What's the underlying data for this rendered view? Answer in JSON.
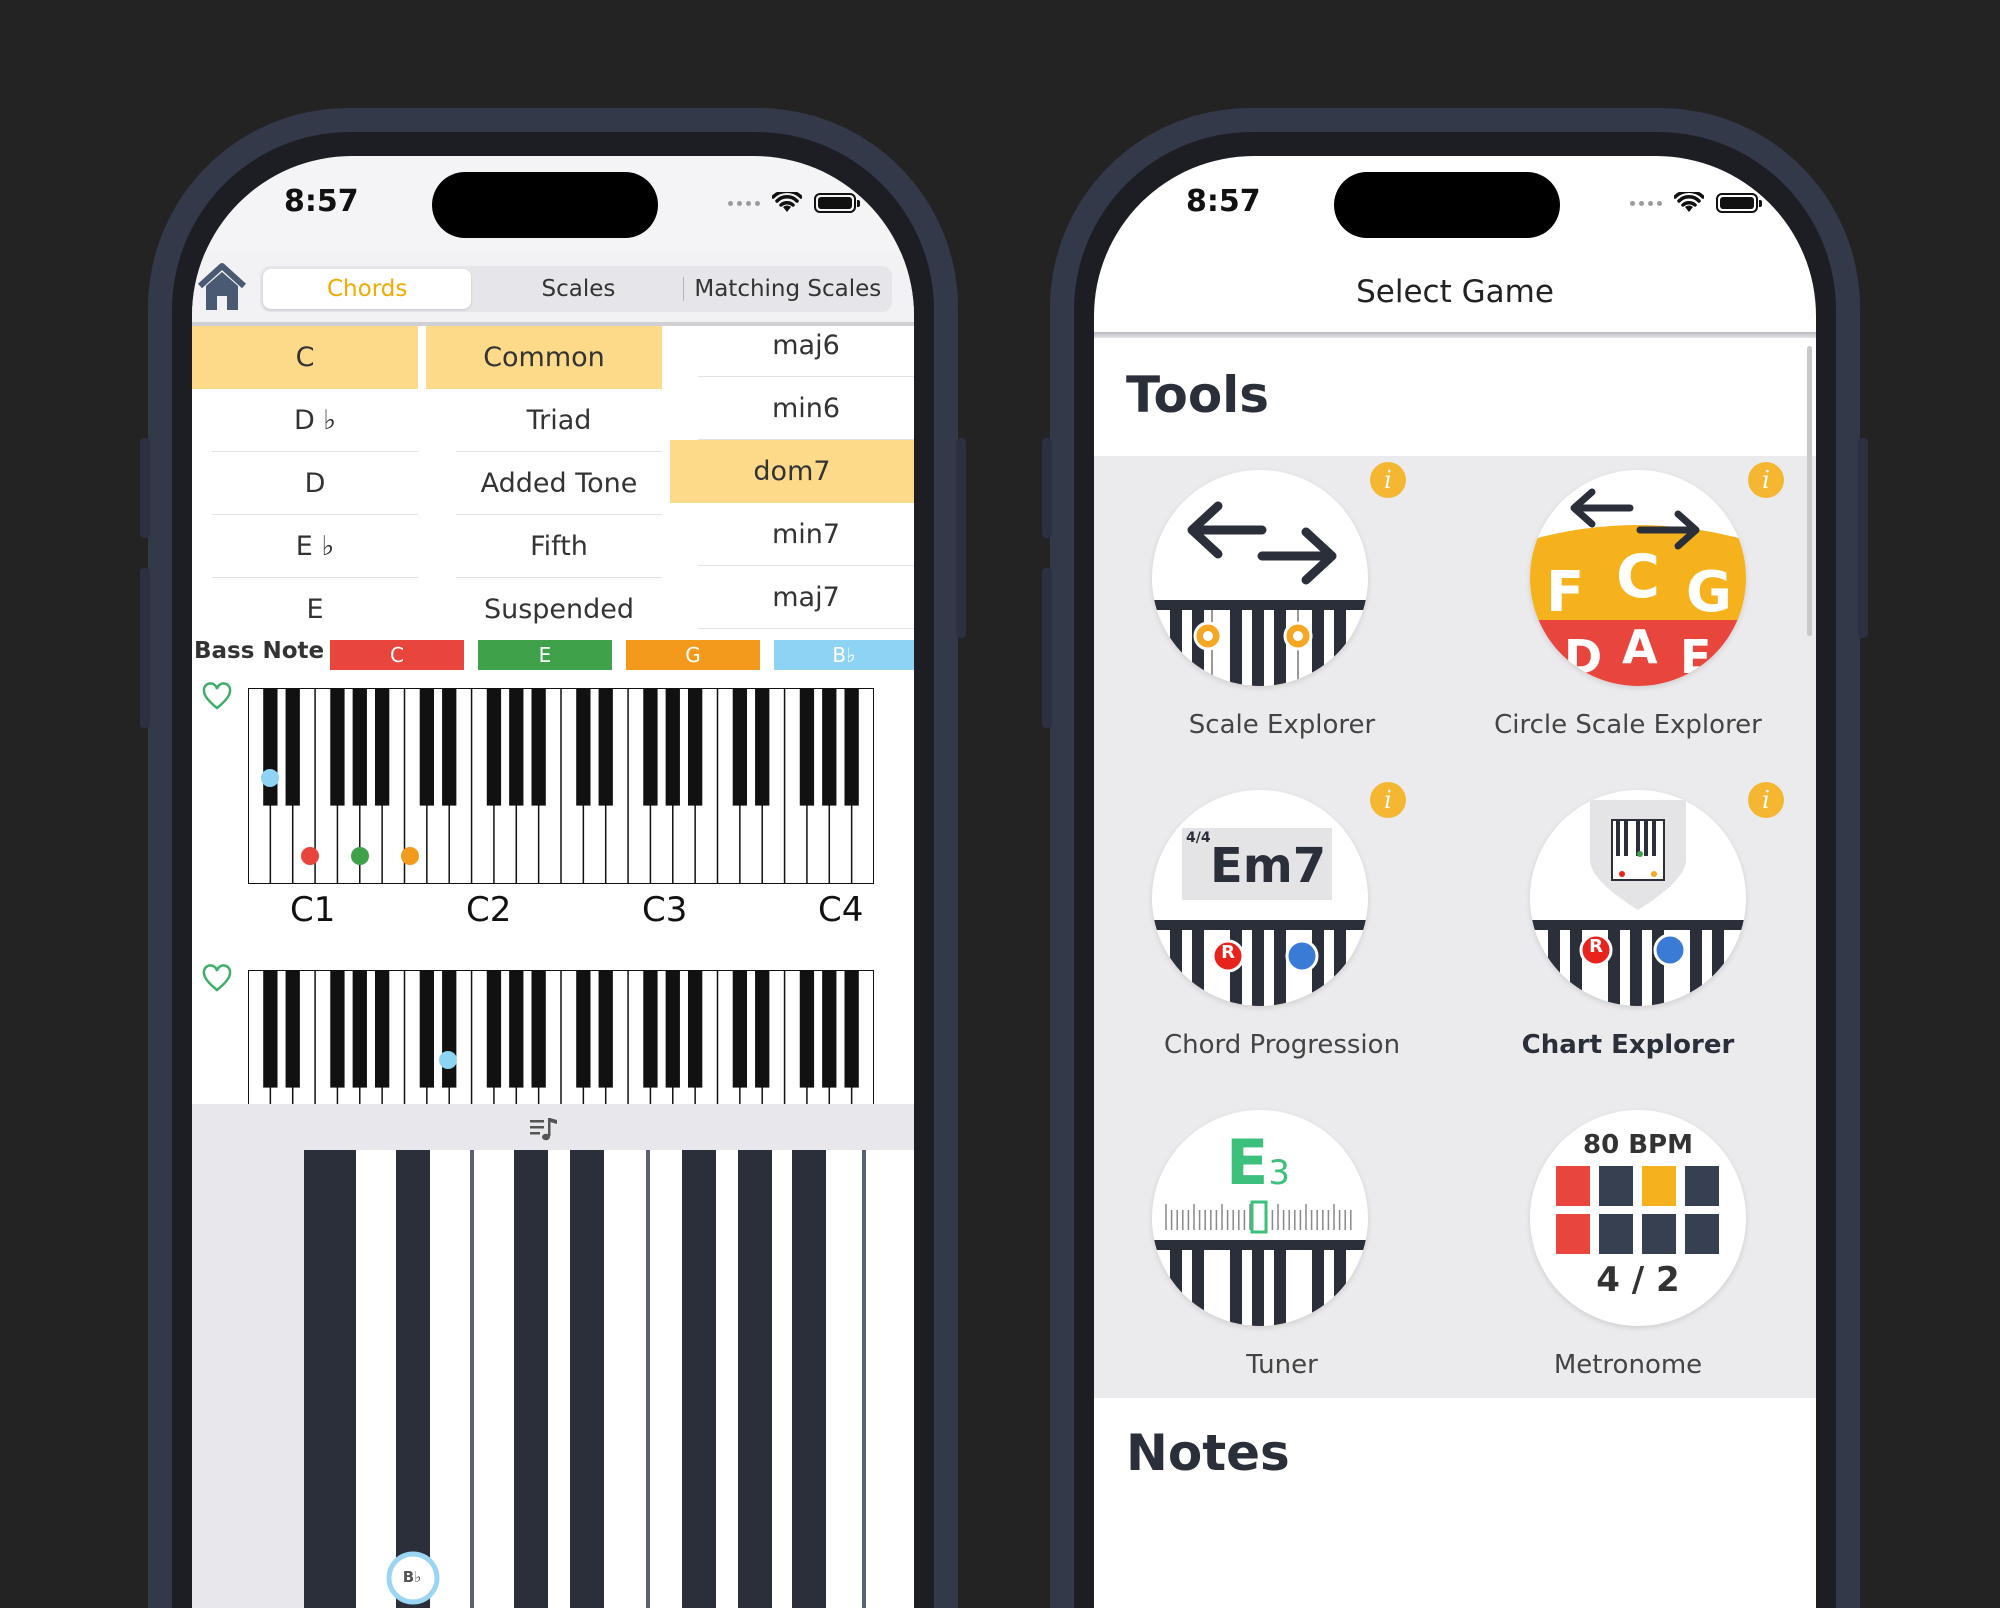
{
  "status": {
    "time": "8:57"
  },
  "chords_screen": {
    "tabs": [
      "Chords",
      "Scales",
      "Matching Scales"
    ],
    "roots": [
      "C",
      "D ♭",
      "D",
      "E ♭",
      "E"
    ],
    "categories": [
      "Common",
      "Triad",
      "Added Tone",
      "Fifth",
      "Suspended"
    ],
    "types": [
      "maj6",
      "min6",
      "dom7",
      "min7",
      "maj7"
    ],
    "bass_label": "Bass Note",
    "bass_notes": [
      {
        "note": "C",
        "color": "#e8463c"
      },
      {
        "note": "E",
        "color": "#3fa24a"
      },
      {
        "note": "G",
        "color": "#f39a1c"
      },
      {
        "note": "B♭",
        "color": "#8fd3f4"
      }
    ],
    "octave_labels": [
      "C1",
      "C2",
      "C3",
      "C4"
    ],
    "bottom_marker": "B♭"
  },
  "game_screen": {
    "title": "Select Game",
    "section_tools": "Tools",
    "section_notes": "Notes",
    "info_glyph": "i",
    "tiles": [
      {
        "label": "Scale Explorer"
      },
      {
        "label": "Circle Scale Explorer",
        "letters_top": [
          "F",
          "C",
          "G"
        ],
        "letters_bottom": [
          "D",
          "A",
          "E"
        ]
      },
      {
        "label": "Chord Progression",
        "chord": "Em7",
        "time_sig": "4/4",
        "root_mark": "R"
      },
      {
        "label": "Chart Explorer",
        "root_mark": "R"
      },
      {
        "label": "Tuner",
        "note": "E",
        "octave": "3"
      },
      {
        "label": "Metronome",
        "bpm": "80 BPM",
        "meter": "4 / 2"
      }
    ]
  }
}
